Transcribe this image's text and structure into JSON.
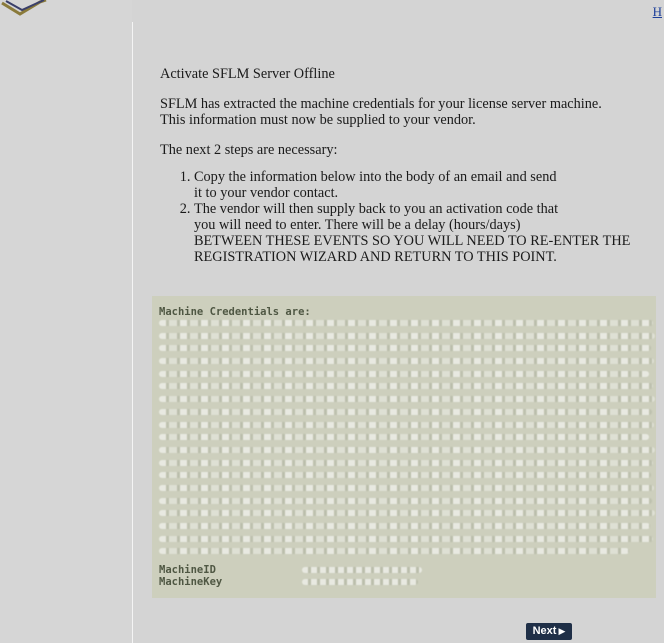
{
  "header": {
    "help_link": "H"
  },
  "main": {
    "title": "Activate SFLM Server Offline",
    "intro_lines": [
      "SFLM has extracted the machine credentials for your license server machine.",
      "This information must now be supplied to your vendor."
    ],
    "steps_lead": "The next 2 steps are necessary:",
    "steps": [
      {
        "lines": [
          "Copy the information below into the body of an email and send",
          "it to your vendor contact."
        ]
      },
      {
        "lines": [
          "The vendor will then supply back to you an activation code that",
          "you will need to enter. There will be a delay (hours/days)",
          "BETWEEN THESE EVENTS SO YOU WILL NEED TO RE-ENTER THE",
          "REGISTRATION WIZARD AND RETURN TO THIS POINT."
        ]
      }
    ]
  },
  "credentials": {
    "label": "Machine Credentials are:",
    "machine_id_label": "MachineID",
    "machine_key_label": "MachineKey"
  },
  "footer": {
    "next_label": "Next",
    "next_icon": "play-arrow-icon"
  },
  "colors": {
    "page_bg": "#d4d4d4",
    "panel_bg": "#cdcfbd",
    "button_bg": "#1f2f47",
    "link": "#1d3f9a"
  }
}
